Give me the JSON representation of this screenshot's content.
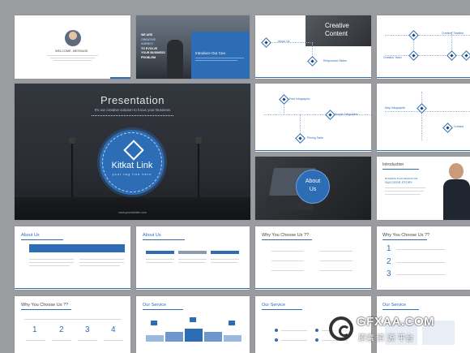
{
  "slide1": {
    "heading": "WELCOME, MESSAGE"
  },
  "slide2": {
    "overlay_text": [
      "WE ARE",
      "CREATIVE",
      "AGENCY",
      "TO EVOLVE",
      "YOUR BUSINESS",
      "PROBLEM"
    ],
    "panel_title": "Introduce Our Ceo"
  },
  "slide3": {
    "title_line1": "Creative",
    "title_line2": "Content",
    "item1": "About Us",
    "item2": "Responsive Slides"
  },
  "slide4": {
    "item1": "Creative Timeline",
    "item2": "Creative Team"
  },
  "hero": {
    "title": "Presentation",
    "subtitle": "It's our creative solution to focus your Business",
    "brand_name": "Kitkat Link",
    "brand_tagline": "your tag line here",
    "website": "www.yourwebsite.com"
  },
  "slide6": {
    "item1": "Free Infographic",
    "item2": "Simple Infographic",
    "item3": "Pricing Table"
  },
  "slide7": {
    "item1": "Map Infographic",
    "item2": "Contact"
  },
  "slide8": {
    "circle_line1": "About",
    "circle_line2": "Us"
  },
  "slide9": {
    "title": "Introduction",
    "subtitle_line1": "BUSINESS PLAN DESIGN FOR",
    "subtitle_line2": "SUCCESS STORY"
  },
  "row3": {
    "s1_title": "About Us",
    "s2_title": "About Us",
    "s3_title": "Why You Choose Us ??",
    "s4_title": "Why You Choose Us ??",
    "s4_numbers": [
      "1",
      "2",
      "3"
    ]
  },
  "row4": {
    "s1_title": "Why You Choose Us ??",
    "s1_numbers": [
      "1",
      "2",
      "3",
      "4"
    ],
    "s2_title": "Our Service",
    "s3_title": "Our Service",
    "s4_title": "Our Service"
  },
  "watermark": {
    "text": "GFXAA.COM",
    "subtext": "原素 资 源 平台"
  },
  "colors": {
    "accent": "#2d6db5",
    "canvas": "#9a9c9f",
    "dark": "#2b2f36"
  }
}
